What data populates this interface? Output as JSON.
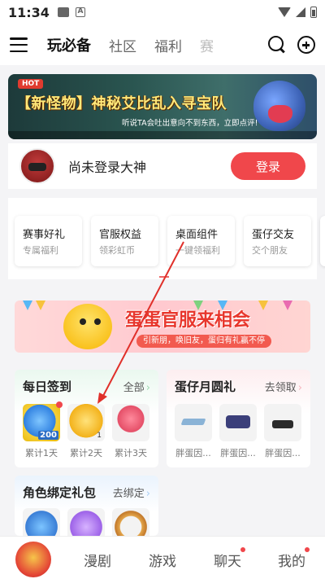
{
  "status_bar": {
    "time": "11:34"
  },
  "header": {
    "tabs": [
      "玩必备",
      "社区",
      "福利",
      "赛"
    ],
    "active_tab": 0
  },
  "banner": {
    "badge": "HOT",
    "title": "【新怪物】神秘艾比乱入寻宝队",
    "subtitle": "听说TA会吐出意向不到东西，立即点评!"
  },
  "login": {
    "name": "尚未登录大神",
    "button": "登录"
  },
  "quick_cards": [
    {
      "title": "赛事好礼",
      "sub": "专属福利"
    },
    {
      "title": "官服权益",
      "sub": "领彩虹币"
    },
    {
      "title": "桌面组件",
      "sub": "一键领福利"
    },
    {
      "title": "蛋仔交友",
      "sub": "交个朋友"
    }
  ],
  "promo": {
    "title": "蛋蛋官服来相会",
    "sub": "引新朋，唤旧友，蛋归有礼赢不停"
  },
  "daily_signin": {
    "title": "每日签到",
    "more": "全部",
    "items": [
      {
        "label": "累计1天",
        "badge": "200"
      },
      {
        "label": "累计2天",
        "badge": "1"
      },
      {
        "label": "累计3天",
        "badge": ""
      }
    ]
  },
  "monthly_gift": {
    "title": "蛋仔月圆礼",
    "more": "去领取",
    "items": [
      {
        "label": "胖蛋因..."
      },
      {
        "label": "胖蛋因..."
      },
      {
        "label": "胖蛋因..."
      }
    ]
  },
  "role_bind": {
    "title": "角色绑定礼包",
    "more": "去绑定"
  },
  "bottom_nav": [
    "漫剧",
    "游戏",
    "聊天",
    "我的"
  ],
  "colors": {
    "accent": "#f0474b",
    "banner_title": "#ffe97a",
    "promo_title": "#e8372d"
  }
}
